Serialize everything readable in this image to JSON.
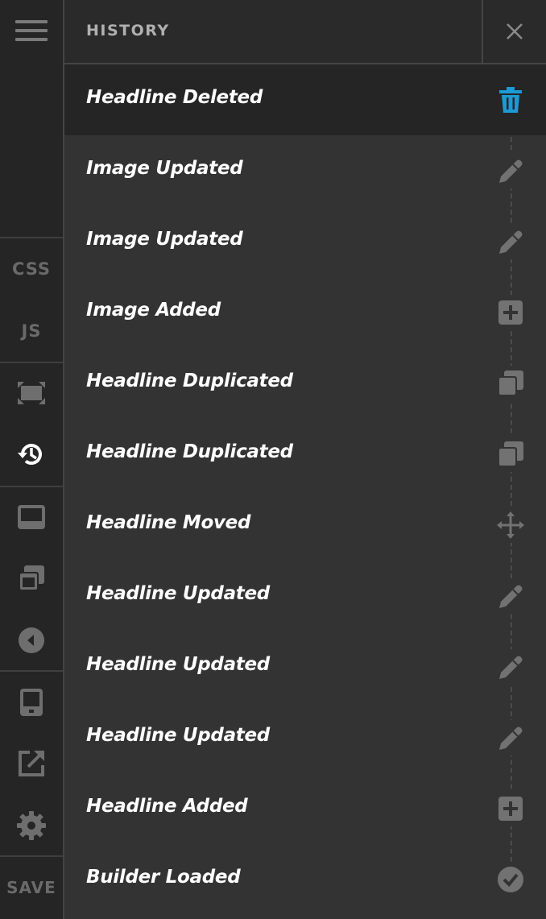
{
  "sidebar": {
    "menu_icon": "hamburger-icon",
    "css_label": "CSS",
    "js_label": "JS",
    "save_label": "SAVE",
    "icons": [
      "resize-icon",
      "history-icon",
      "footer-bar-icon",
      "duplicate-windows-icon",
      "collapse-left-icon",
      "mobile-preview-icon",
      "external-link-icon",
      "gear-icon"
    ]
  },
  "header": {
    "title": "HISTORY",
    "close_icon": "close-icon"
  },
  "history": [
    {
      "label": "Headline Deleted",
      "icon": "trash-icon",
      "active": true
    },
    {
      "label": "Image Updated",
      "icon": "pencil-icon"
    },
    {
      "label": "Image Updated",
      "icon": "pencil-icon"
    },
    {
      "label": "Image Added",
      "icon": "plus-square-icon"
    },
    {
      "label": "Headline Duplicated",
      "icon": "duplicate-icon"
    },
    {
      "label": "Headline Duplicated",
      "icon": "duplicate-icon"
    },
    {
      "label": "Headline Moved",
      "icon": "move-icon"
    },
    {
      "label": "Headline Updated",
      "icon": "pencil-icon"
    },
    {
      "label": "Headline Updated",
      "icon": "pencil-icon"
    },
    {
      "label": "Headline Updated",
      "icon": "pencil-icon"
    },
    {
      "label": "Headline Added",
      "icon": "plus-square-icon"
    },
    {
      "label": "Builder Loaded",
      "icon": "check-circle-icon"
    }
  ],
  "colors": {
    "accent": "#1b9ad6",
    "icon_gray": "#727272"
  }
}
